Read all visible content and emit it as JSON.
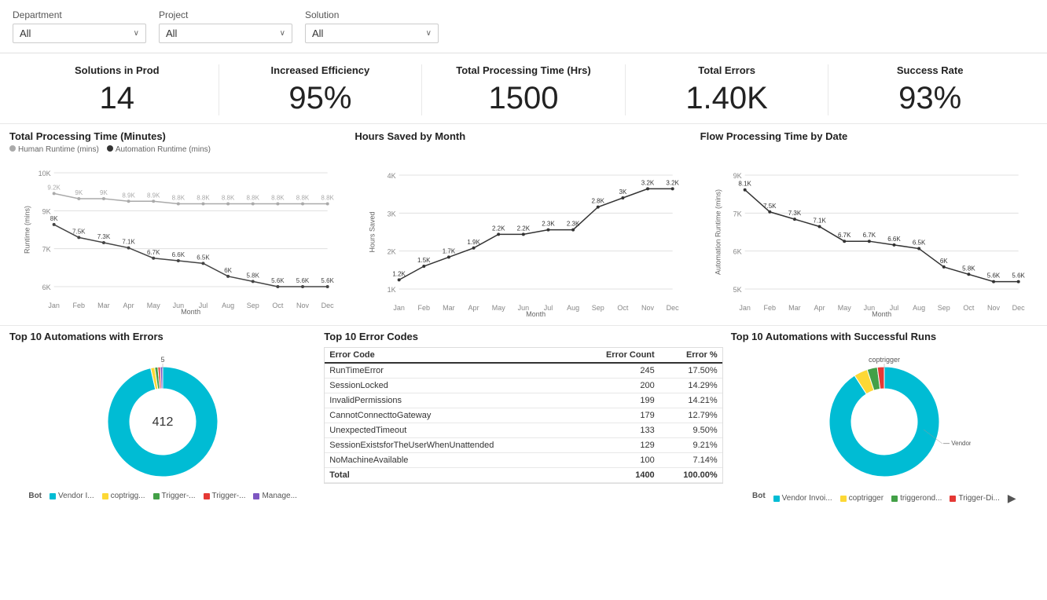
{
  "filters": {
    "department": {
      "label": "Department",
      "value": "All"
    },
    "project": {
      "label": "Project",
      "value": "All"
    },
    "solution": {
      "label": "Solution",
      "value": "All"
    }
  },
  "kpis": [
    {
      "title": "Solutions in Prod",
      "value": "14"
    },
    {
      "title": "Increased Efficiency",
      "value": "95%"
    },
    {
      "title": "Total Processing Time (Hrs)",
      "value": "1500"
    },
    {
      "title": "Total Errors",
      "value": "1.40K"
    },
    {
      "title": "Success Rate",
      "value": "93%"
    }
  ],
  "charts": {
    "processing_time": {
      "title": "Total Processing Time (Minutes)",
      "legend": [
        {
          "label": "Human Runtime (mins)",
          "color": "#aaa"
        },
        {
          "label": "Automation Runtime (mins)",
          "color": "#333"
        }
      ],
      "xaxis_label": "Month",
      "yaxis_label": "Runtime (mins)",
      "months": [
        "Jan",
        "Feb",
        "Mar",
        "Apr",
        "May",
        "Jun",
        "Jul",
        "Aug",
        "Sep",
        "Oct",
        "Nov",
        "Dec"
      ],
      "human": [
        9200,
        9000,
        9000,
        8900,
        8900,
        8800,
        8800,
        8800,
        8800,
        8800,
        8800,
        8800
      ],
      "automation": [
        8000,
        7500,
        7300,
        7100,
        6700,
        6600,
        6500,
        6000,
        5800,
        5600,
        5600,
        5600
      ]
    },
    "hours_saved": {
      "title": "Hours Saved by Month",
      "xaxis_label": "Month",
      "yaxis_label": "Hours Saved",
      "months": [
        "Jan",
        "Feb",
        "Mar",
        "Apr",
        "May",
        "Jun",
        "Jul",
        "Aug",
        "Sep",
        "Oct",
        "Nov",
        "Dec"
      ],
      "values": [
        1200,
        1500,
        1700,
        1900,
        2200,
        2200,
        2300,
        2300,
        2800,
        3000,
        3200,
        3200
      ]
    },
    "flow_processing": {
      "title": "Flow Processing Time by Date",
      "xaxis_label": "Month",
      "yaxis_label": "Automation Runtime (mins)",
      "months": [
        "Jan",
        "Feb",
        "Mar",
        "Apr",
        "May",
        "Jun",
        "Jul",
        "Aug",
        "Sep",
        "Oct",
        "Nov",
        "Dec"
      ],
      "values": [
        8100,
        7500,
        7300,
        7100,
        6700,
        6700,
        6600,
        6500,
        6000,
        5800,
        5600,
        5600
      ]
    }
  },
  "top_errors": {
    "title": "Top 10 Automations with Errors",
    "donut_label_inner": "412",
    "donut_label_top": "5",
    "segments": [
      {
        "label": "Vendor I...",
        "color": "#00bcd4",
        "value": 412,
        "pct": 0.88
      },
      {
        "label": "coptrigg...",
        "color": "#fdd835",
        "value": 5,
        "pct": 0.01
      },
      {
        "label": "Trigger-...",
        "color": "#43a047",
        "value": 4,
        "pct": 0.01
      },
      {
        "label": "Trigger-...",
        "color": "#e53935",
        "value": 3,
        "pct": 0.01
      },
      {
        "label": "Manage...",
        "color": "#7e57c2",
        "value": 3,
        "pct": 0.01
      }
    ],
    "legend_prefix": "Bot"
  },
  "error_codes": {
    "title": "Top 10 Error Codes",
    "columns": [
      "Error Code",
      "Error Count",
      "Error %"
    ],
    "rows": [
      {
        "code": "RunTimeError",
        "count": 245,
        "pct": "17.50%"
      },
      {
        "code": "SessionLocked",
        "count": 200,
        "pct": "14.29%"
      },
      {
        "code": "InvalidPermissions",
        "count": 199,
        "pct": "14.21%"
      },
      {
        "code": "CannotConnecttoGateway",
        "count": 179,
        "pct": "12.79%"
      },
      {
        "code": "UnexpectedTimeout",
        "count": 133,
        "pct": "9.50%"
      },
      {
        "code": "SessionExistsforTheUserWhenUnattended",
        "count": 129,
        "pct": "9.21%"
      },
      {
        "code": "NoMachineAvailable",
        "count": 100,
        "pct": "7.14%"
      }
    ],
    "total_count": "1400",
    "total_pct": "100.00%"
  },
  "top_success": {
    "title": "Top 10 Automations with Successful Runs",
    "donut_label_top": "coptrigger",
    "segments": [
      {
        "label": "Vendor Invoi...",
        "color": "#00bcd4",
        "value": 900,
        "pct": 0.85
      },
      {
        "label": "coptrigger",
        "color": "#fdd835",
        "value": 40,
        "pct": 0.04
      },
      {
        "label": "triggerond...",
        "color": "#43a047",
        "value": 30,
        "pct": 0.03
      },
      {
        "label": "Trigger-Di...",
        "color": "#e53935",
        "value": 20,
        "pct": 0.02
      }
    ],
    "vendor_label": "Vendor Invoice Processing Cl...",
    "legend_prefix": "Bot"
  }
}
